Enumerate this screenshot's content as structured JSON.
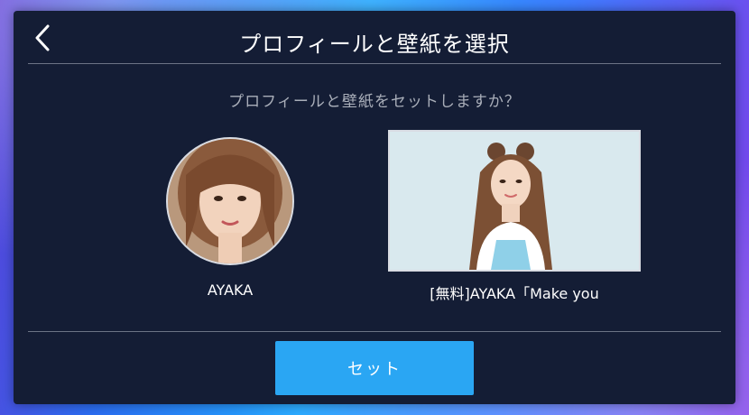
{
  "header": {
    "title": "プロフィールと壁紙を選択",
    "back_icon": "chevron-left-icon"
  },
  "prompt": "プロフィールと壁紙をセットしますか？",
  "profile": {
    "name": "AYAKA"
  },
  "wallpaper": {
    "name": "[無料]AYAKA「Make you"
  },
  "actions": {
    "set_label": "セット"
  },
  "colors": {
    "panel_bg": "#141d35",
    "accent_button": "#2aa6f3",
    "divider": "#6c7385",
    "muted_text": "#a9aeb9"
  }
}
